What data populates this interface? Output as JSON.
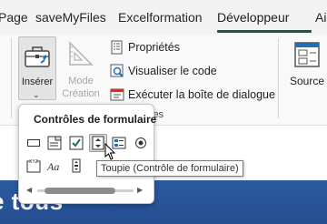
{
  "tabs": [
    {
      "label": "Page"
    },
    {
      "label": "saveMyFiles"
    },
    {
      "label": "Excelformation"
    },
    {
      "label": "Développeur"
    },
    {
      "label": "Aide"
    }
  ],
  "ribbon": {
    "inserer_label": "Insérer",
    "mode_line1": "Mode",
    "mode_line2": "Création",
    "proprietes_label": "Propriétés",
    "visualiser_label": "Visualiser le code",
    "executer_label": "Exécuter la boîte de dialogue",
    "controles_fragment": "les",
    "source_label": "Source"
  },
  "dropdown": {
    "title": "Contrôles de formulaire",
    "icons": [
      "button-icon",
      "combo-box-icon",
      "checkbox-icon",
      "spinner-icon",
      "list-box-icon",
      "option-button-icon",
      "group-box-icon",
      "label-icon",
      "scrollbar-icon"
    ]
  },
  "tooltip": {
    "text": "Toupie (Contrôle de formulaire)"
  },
  "banner": {
    "text": "e tous"
  },
  "colors": {
    "tab_underline": "#185c37",
    "banner": "#2c5aa0"
  }
}
